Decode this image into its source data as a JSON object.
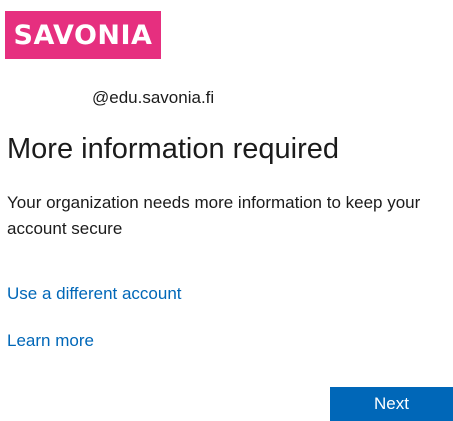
{
  "brand": {
    "logo_text": "SAVONIA",
    "logo_color": "#e62f7f"
  },
  "identity": {
    "email": "@edu.savonia.fi"
  },
  "main": {
    "title": "More information required",
    "description": "Your organization needs more information to keep your account secure"
  },
  "links": {
    "different_account": "Use a different account",
    "learn_more": "Learn more",
    "link_color": "#0067b8"
  },
  "actions": {
    "next_label": "Next",
    "button_color": "#0067b8"
  }
}
